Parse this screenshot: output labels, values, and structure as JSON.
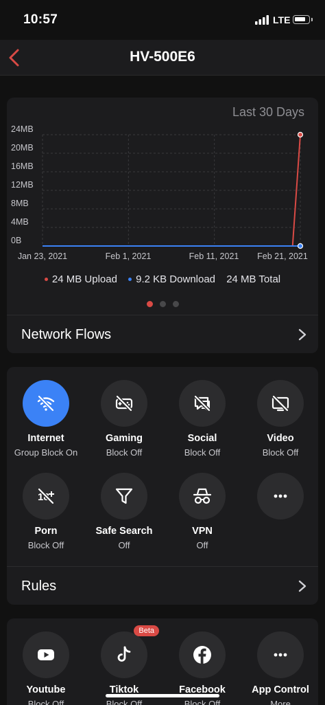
{
  "status": {
    "time": "10:57",
    "network": "LTE"
  },
  "nav": {
    "title": "HV-500E6"
  },
  "usage": {
    "range_label": "Last 30 Days",
    "legend": {
      "upload": "24 MB Upload",
      "download": "9.2 KB Download",
      "total": "24 MB Total"
    },
    "network_flows_label": "Network Flows"
  },
  "chart_data": {
    "type": "line",
    "yticks": [
      "24MB",
      "20MB",
      "16MB",
      "12MB",
      "8MB",
      "4MB",
      "0B"
    ],
    "xticks": [
      "Jan 23, 2021",
      "Feb 1, 2021",
      "Feb 11, 2021",
      "Feb 21, 2021"
    ],
    "ylim": [
      0,
      24
    ],
    "grid": true,
    "series": [
      {
        "name": "Upload",
        "color": "#d94a45",
        "points": [
          [
            0,
            0
          ],
          [
            0.97,
            0
          ],
          [
            1.0,
            24
          ]
        ]
      },
      {
        "name": "Download",
        "color": "#3b82f6",
        "points": [
          [
            0,
            0
          ],
          [
            1.0,
            0.001
          ]
        ]
      }
    ]
  },
  "controls": {
    "tiles": [
      {
        "label": "Internet",
        "sub": "Group Block On",
        "icon": "wifi-off-icon",
        "active": true
      },
      {
        "label": "Gaming",
        "sub": "Block Off",
        "icon": "gamepad-off-icon"
      },
      {
        "label": "Social",
        "sub": "Block Off",
        "icon": "social-off-icon"
      },
      {
        "label": "Video",
        "sub": "Block Off",
        "icon": "video-off-icon"
      },
      {
        "label": "Porn",
        "sub": "Block Off",
        "icon": "18-plus-off-icon"
      },
      {
        "label": "Safe Search",
        "sub": "Off",
        "icon": "filter-icon"
      },
      {
        "label": "VPN",
        "sub": "Off",
        "icon": "incognito-icon"
      },
      {
        "label": "",
        "sub": "",
        "icon": "more-icon"
      }
    ],
    "rules_label": "Rules"
  },
  "apps": {
    "tiles": [
      {
        "label": "Youtube",
        "sub": "Block Off",
        "icon": "youtube-icon"
      },
      {
        "label": "Tiktok",
        "sub": "Block Off",
        "icon": "tiktok-icon",
        "badge": "Beta"
      },
      {
        "label": "Facebook",
        "sub": "Block Off",
        "icon": "facebook-icon"
      },
      {
        "label": "App Control",
        "sub": "More",
        "icon": "more-icon"
      }
    ]
  }
}
